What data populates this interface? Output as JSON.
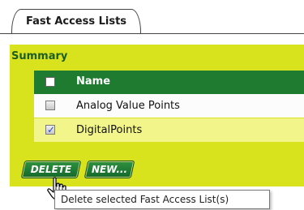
{
  "tabs": [
    {
      "label": "Fast Access Lists"
    }
  ],
  "panel": {
    "title": "Summary"
  },
  "table": {
    "header": {
      "name_label": "Name",
      "checked": false
    },
    "rows": [
      {
        "name": "Analog Value Points",
        "checked": false,
        "selected": false
      },
      {
        "name": "DigitalPoints",
        "checked": true,
        "selected": true
      }
    ]
  },
  "buttons": {
    "delete_label": "DELETE",
    "new_label": "NEW..."
  },
  "tooltip": {
    "text": "Delete selected Fast Access List(s)"
  },
  "colors": {
    "panel_background": "#d8e21d",
    "header_background": "#1e7b2f",
    "selected_row": "#f2f58a",
    "button_green": "#1e7b2f",
    "title_green": "#1b5e20"
  },
  "icons": {
    "checkmark": "checkmark-icon",
    "cursor": "hand-pointer-icon"
  }
}
